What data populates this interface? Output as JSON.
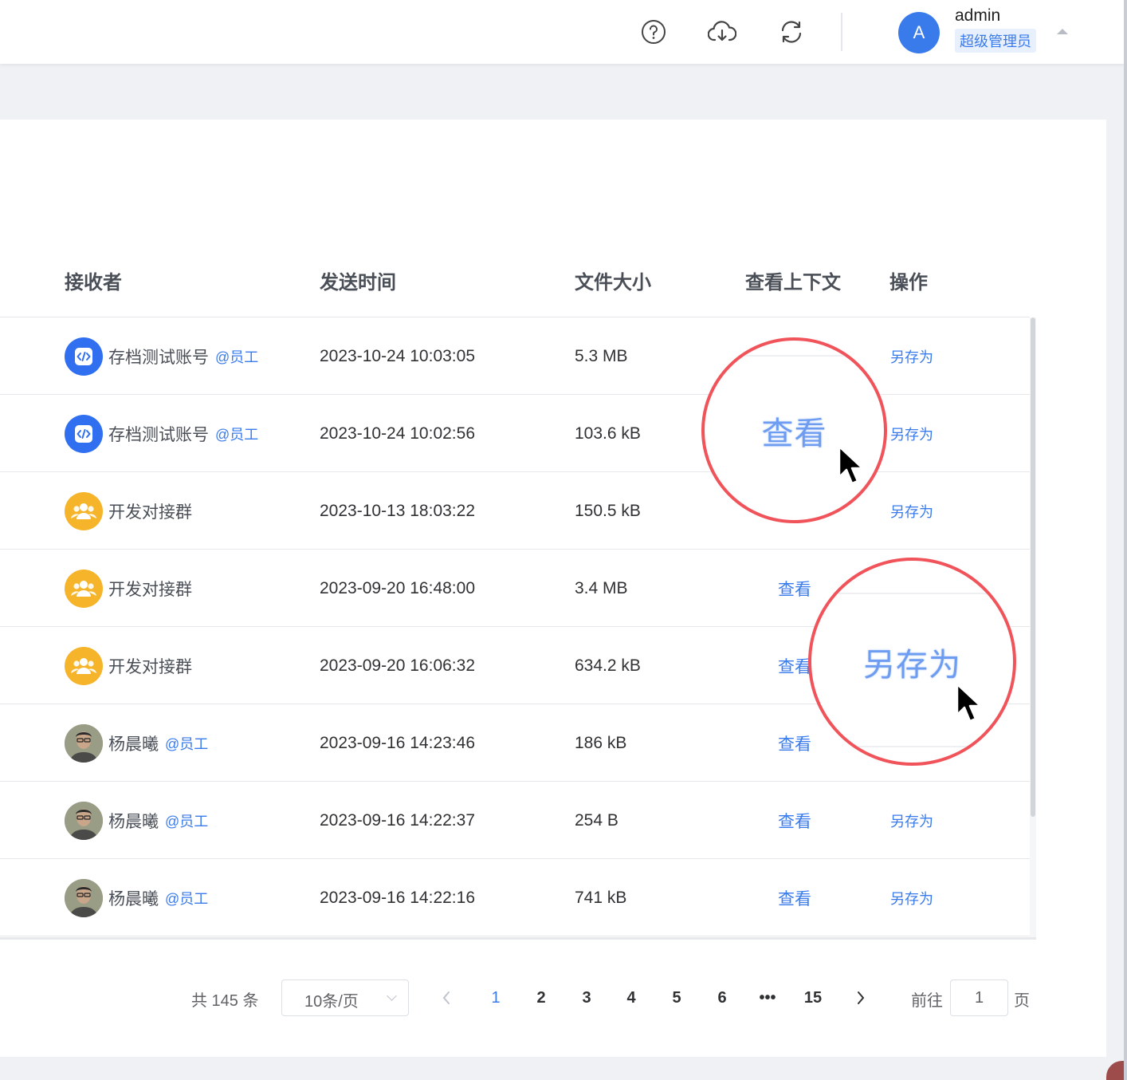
{
  "header": {
    "icons": [
      "help-icon",
      "cloud-download-icon",
      "refresh-icon"
    ],
    "user": {
      "avatar_letter": "A",
      "name": "admin",
      "role": "超级管理员"
    }
  },
  "table": {
    "columns": [
      "接收者",
      "发送时间",
      "文件大小",
      "查看上下文",
      "操作"
    ],
    "rows": [
      {
        "avatar": "code",
        "name": "存档测试账号",
        "tag": "@员工",
        "time": "2023-10-24 10:03:05",
        "size": "5.3 MB",
        "view": "",
        "action": "另存为"
      },
      {
        "avatar": "code",
        "name": "存档测试账号",
        "tag": "@员工",
        "time": "2023-10-24 10:02:56",
        "size": "103.6 kB",
        "view": "",
        "action": "另存为"
      },
      {
        "avatar": "group",
        "name": "开发对接群",
        "tag": "",
        "time": "2023-10-13 18:03:22",
        "size": "150.5 kB",
        "view": "",
        "action": "另存为"
      },
      {
        "avatar": "group",
        "name": "开发对接群",
        "tag": "",
        "time": "2023-09-20 16:48:00",
        "size": "3.4 MB",
        "view": "查看",
        "action": ""
      },
      {
        "avatar": "group",
        "name": "开发对接群",
        "tag": "",
        "time": "2023-09-20 16:06:32",
        "size": "634.2 kB",
        "view": "查看",
        "action": ""
      },
      {
        "avatar": "person",
        "name": "杨晨曦",
        "tag": "@员工",
        "time": "2023-09-16 14:23:46",
        "size": "186 kB",
        "view": "查看",
        "action": ""
      },
      {
        "avatar": "person",
        "name": "杨晨曦",
        "tag": "@员工",
        "time": "2023-09-16 14:22:37",
        "size": "254 B",
        "view": "查看",
        "action": "另存为"
      },
      {
        "avatar": "person",
        "name": "杨晨曦",
        "tag": "@员工",
        "time": "2023-09-16 14:22:16",
        "size": "741 kB",
        "view": "查看",
        "action": "另存为"
      }
    ]
  },
  "pagination": {
    "total": "共 145 条",
    "page_size": "10条/页",
    "pages": [
      "1",
      "2",
      "3",
      "4",
      "5",
      "6",
      "•••",
      "15"
    ],
    "active_page": "1",
    "goto_label": "前往",
    "goto_value": "1",
    "page_suffix": "页"
  },
  "callouts": {
    "view_zoom": "查看",
    "save_as_zoom": "另存为"
  },
  "colors": {
    "accent": "#3a7bec",
    "callout_ring": "#f0545a",
    "group_avatar": "#f5b42a",
    "code_avatar": "#2f6ff0"
  }
}
